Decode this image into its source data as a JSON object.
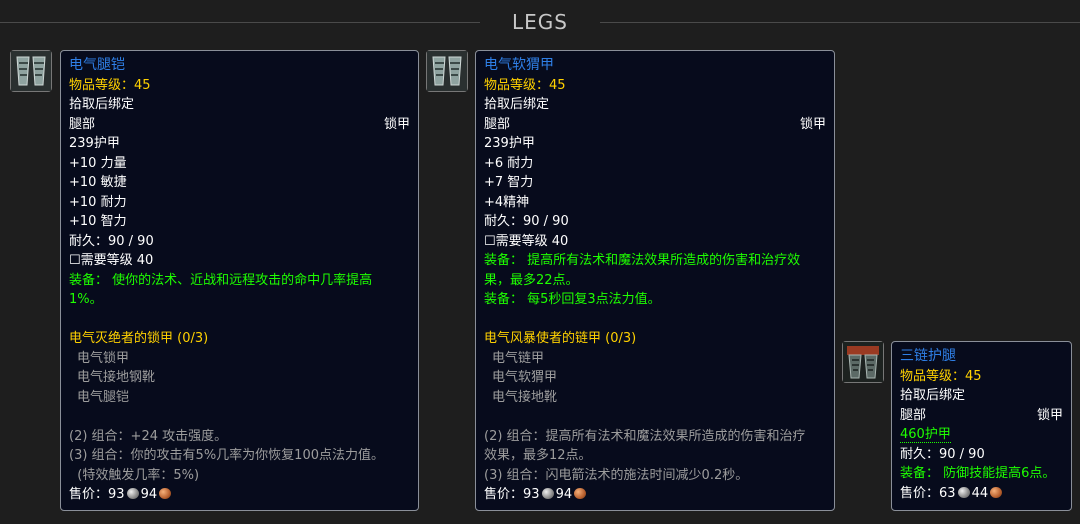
{
  "section_title": "LEGS",
  "items": [
    {
      "name": "电气腿铠",
      "item_level": "物品等级：45",
      "bind": "拾取后绑定",
      "slot": "腿部",
      "armor_type": "锁甲",
      "armor": "239护甲",
      "stats": [
        "+10 力量",
        "+10 敏捷",
        "+10 耐力",
        "+10 智力"
      ],
      "durability": "耐久：90 / 90",
      "required_level": "☐需要等级 40",
      "equip": [
        "装备：  使你的法术、近战和远程攻击的命中几率提高",
        "1%。"
      ],
      "set_name": "电气灭绝者的锁甲 (0/3)",
      "set_items": [
        "电气锁甲",
        "电气接地钢靴",
        "电气腿铠"
      ],
      "set_bonuses": [
        "(2) 组合：+24 攻击强度。",
        "(3) 组合：你的攻击有5%几率为你恢复100点法力值。",
        "  (特效触发几率：5%)"
      ],
      "sell_label": "售价：",
      "sell_silver": "93",
      "sell_copper": "94",
      "icon": "mail-leggings-icon"
    },
    {
      "name": "电气软猬甲",
      "item_level": "物品等级：45",
      "bind": "拾取后绑定",
      "slot": "腿部",
      "armor_type": "锁甲",
      "armor": "239护甲",
      "stats": [
        "+6 耐力",
        "+7 智力",
        "+4精神"
      ],
      "durability": "耐久：90 / 90",
      "required_level": "☐需要等级 40",
      "equip": [
        "装备：  提高所有法术和魔法效果所造成的伤害和治疗效",
        "果，最多22点。",
        "装备：  每5秒回复3点法力值。"
      ],
      "set_name": "电气风暴使者的链甲 (0/3)",
      "set_items": [
        "电气链甲",
        "电气软猬甲",
        "电气接地靴"
      ],
      "set_bonuses": [
        "(2) 组合：提高所有法术和魔法效果所造成的伤害和治疗",
        "效果，最多12点。",
        "(3) 组合：闪电箭法术的施法时间减少0.2秒。"
      ],
      "sell_label": "售价：",
      "sell_silver": "93",
      "sell_copper": "94",
      "icon": "mail-leggings-icon"
    },
    {
      "name": "三链护腿",
      "item_level": "物品等级：45",
      "bind": "拾取后绑定",
      "slot": "腿部",
      "armor_type": "锁甲",
      "armor": "460护甲",
      "durability": "耐久：90 / 90",
      "equip": "装备：  防御技能提高6点。",
      "sell_label": "售价：",
      "sell_silver": "63",
      "sell_copper": "44",
      "icon": "chain-leggings-icon"
    }
  ],
  "colors": {
    "background": "#1e1e1e",
    "tooltip_bg": "#070b1c",
    "item_name": "#2f7fe6",
    "item_level": "#ffd100",
    "equip_green": "#1eff00",
    "set_gold": "#ffd100",
    "set_gray": "#9d9d9d"
  }
}
